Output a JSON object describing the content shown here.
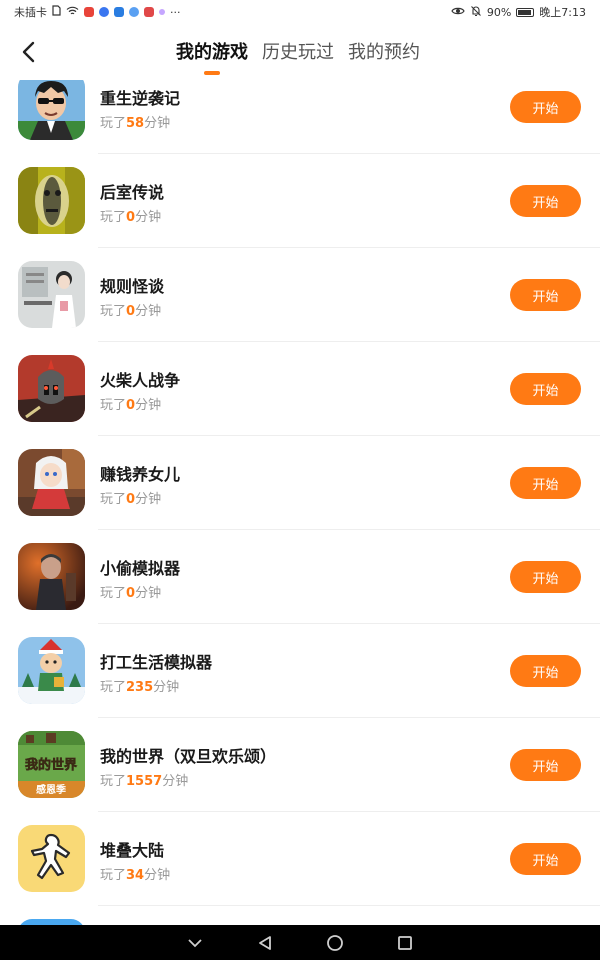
{
  "status_bar": {
    "carrier": "未插卡",
    "more": "···",
    "battery": "90%",
    "time": "晚上7:13",
    "colors": [
      "#3a76f0",
      "#e8443a",
      "#2a7de1",
      "#5aa0f2",
      "#e04848",
      "#8a5cf0"
    ]
  },
  "header": {
    "back_icon": "chevron-left-icon",
    "tabs": [
      {
        "label": "我的游戏",
        "active": true
      },
      {
        "label": "历史玩过",
        "active": false
      },
      {
        "label": "我的预约",
        "active": false
      }
    ]
  },
  "games": [
    {
      "title": "重生逆袭记",
      "prefix": "玩了",
      "minutes": "58",
      "suffix": "分钟",
      "button": "开始"
    },
    {
      "title": "后室传说",
      "prefix": "玩了",
      "minutes": "0",
      "suffix": "分钟",
      "button": "开始"
    },
    {
      "title": "规则怪谈",
      "prefix": "玩了",
      "minutes": "0",
      "suffix": "分钟",
      "button": "开始"
    },
    {
      "title": "火柴人战争",
      "prefix": "玩了",
      "minutes": "0",
      "suffix": "分钟",
      "button": "开始"
    },
    {
      "title": "赚钱养女儿",
      "prefix": "玩了",
      "minutes": "0",
      "suffix": "分钟",
      "button": "开始"
    },
    {
      "title": "小偷模拟器",
      "prefix": "玩了",
      "minutes": "0",
      "suffix": "分钟",
      "button": "开始"
    },
    {
      "title": "打工生活模拟器",
      "prefix": "玩了",
      "minutes": "235",
      "suffix": "分钟",
      "button": "开始"
    },
    {
      "title": "我的世界（双旦欢乐颂）",
      "prefix": "玩了",
      "minutes": "1557",
      "suffix": "分钟",
      "button": "开始"
    },
    {
      "title": "堆叠大陆",
      "prefix": "玩了",
      "minutes": "34",
      "suffix": "分钟",
      "button": "开始"
    },
    {
      "title": "",
      "prefix": "",
      "minutes": "",
      "suffix": "",
      "button": ""
    }
  ],
  "minecraft_icon_text": [
    "我的世界",
    "感恩季"
  ],
  "nav_bar": {
    "icons": [
      "chevron-down-icon",
      "back-triangle-icon",
      "home-circle-icon",
      "recents-square-icon"
    ]
  },
  "accent_color": "#ff7a14"
}
